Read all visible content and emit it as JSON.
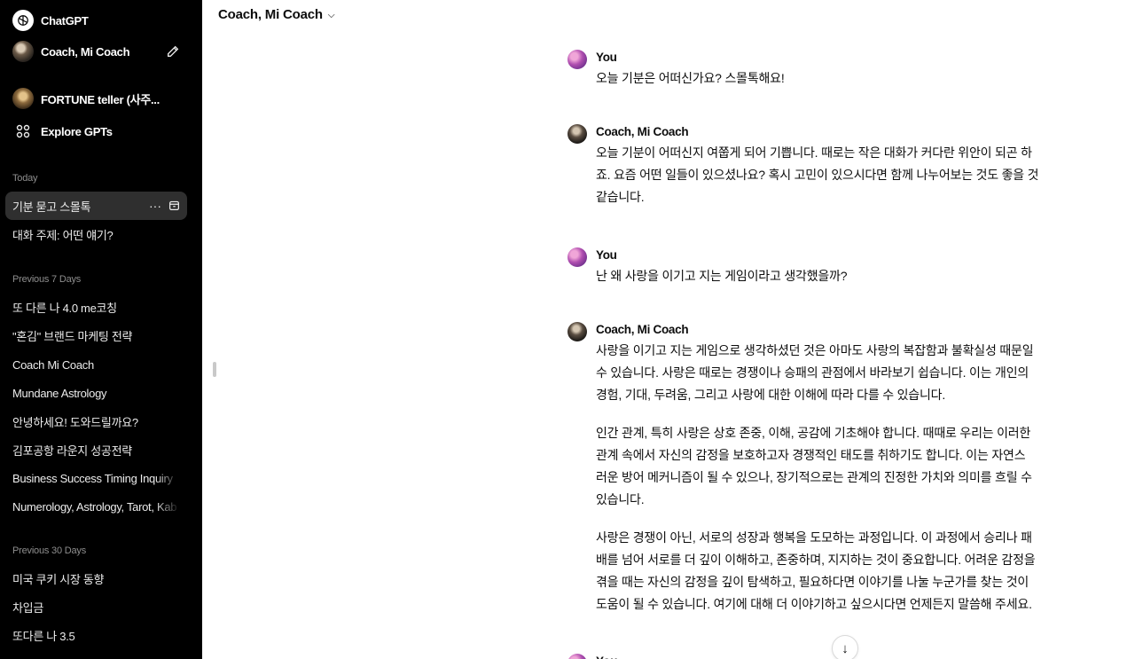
{
  "sidebar": {
    "app_name": "ChatGPT",
    "current_gpt": "Coach, Mi Coach",
    "pinned_gpt": "FORTUNE teller (사주...",
    "explore_label": "Explore GPTs",
    "sections": [
      {
        "title": "Today",
        "items": [
          "기분 묻고 스몰톡",
          "대화 주제: 어떤 얘기?"
        ]
      },
      {
        "title": "Previous 7 Days",
        "items": [
          "또 다른 나 4.0 me코칭",
          "\"혼김\" 브랜드 마케팅 전략",
          "Coach Mi Coach",
          "Mundane Astrology",
          "안녕하세요! 도와드릴까요?",
          "김포공항 라운지 성공전략",
          "Business Success Timing Inquiry",
          "Numerology, Astrology, Tarot, Kab"
        ]
      },
      {
        "title": "Previous 30 Days",
        "items": [
          "미국 쿠키 시장 동향",
          "차입금",
          "또다른 나 3.5"
        ]
      }
    ],
    "icons": {
      "logo": "chatgpt-logo-icon",
      "new_chat": "edit-icon",
      "explore": "grid-icon",
      "more": "more-icon",
      "archive": "archive-icon"
    }
  },
  "header": {
    "title": "Coach, Mi Coach"
  },
  "conversation": [
    {
      "role": "You",
      "paragraphs": [
        "오늘 기분은 어떠신가요? 스몰톡해요!"
      ]
    },
    {
      "role": "Coach, Mi Coach",
      "paragraphs": [
        "오늘 기분이 어떠신지 여쭙게 되어 기쁩니다. 때로는 작은 대화가 커다란 위안이 되곤 하\n죠. 요즘 어떤 일들이 있으셨나요? 혹시 고민이 있으시다면 함께 나누어보는 것도 좋을 것\n같습니다."
      ]
    },
    {
      "role": "You",
      "paragraphs": [
        "난 왜 사랑을 이기고 지는 게임이라고 생각했을까?"
      ]
    },
    {
      "role": "Coach, Mi Coach",
      "paragraphs": [
        "사랑을 이기고 지는 게임으로 생각하셨던 것은 아마도 사랑의 복잡함과 불확실성 때문일\n수 있습니다. 사랑은 때로는 경쟁이나 승패의 관점에서 바라보기 쉽습니다. 이는 개인의\n경험, 기대, 두려움, 그리고 사랑에 대한 이해에 따라 다를 수 있습니다.",
        "인간 관계, 특히 사랑은 상호 존중, 이해, 공감에 기초해야 합니다. 때때로 우리는 이러한\n관계 속에서 자신의 감정을 보호하고자 경쟁적인 태도를 취하기도 합니다. 이는 자연스\n러운 방어 메커니즘이 될 수 있으나, 장기적으로는 관계의 진정한 가치와 의미를 흐릴 수\n있습니다.",
        "사랑은 경쟁이 아닌, 서로의 성장과 행복을 도모하는 과정입니다. 이 과정에서 승리나 패\n배를 넘어 서로를 더 깊이 이해하고, 존중하며, 지지하는 것이 중요합니다. 어려운 감정을\n겪을 때는 자신의 감정을 깊이 탐색하고, 필요하다면 이야기를 나눌 누군가를 찾는 것이\n도움이 될 수 있습니다. 여기에 대해 더 이야기하고 싶으시다면 언제든지 말씀해 주세요."
      ]
    },
    {
      "role": "You",
      "paragraphs": []
    }
  ],
  "scroll_down_icon": "arrow-down-icon"
}
